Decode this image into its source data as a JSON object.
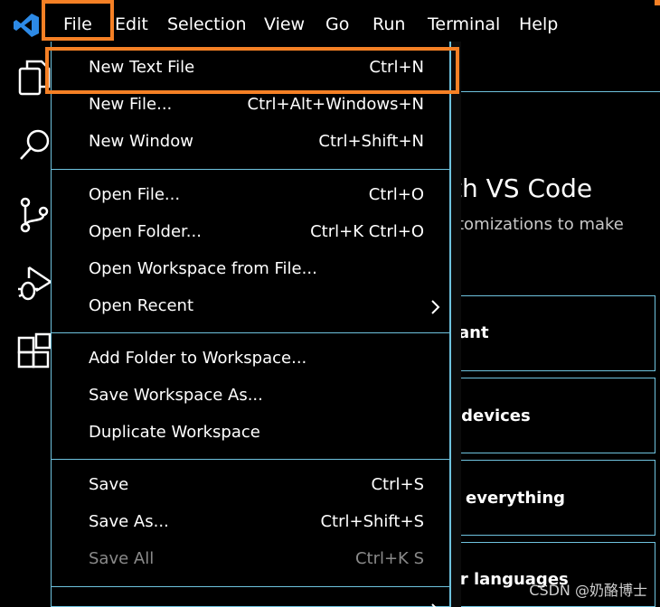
{
  "menubar": {
    "items": [
      {
        "label": "File"
      },
      {
        "label": "Edit"
      },
      {
        "label": "Selection"
      },
      {
        "label": "View"
      },
      {
        "label": "Go"
      },
      {
        "label": "Run"
      },
      {
        "label": "Terminal"
      },
      {
        "label": "Help"
      }
    ]
  },
  "file_menu": {
    "groups": [
      [
        {
          "label": "New Text File",
          "shortcut": "Ctrl+N"
        },
        {
          "label": "New File...",
          "shortcut": "Ctrl+Alt+Windows+N"
        },
        {
          "label": "New Window",
          "shortcut": "Ctrl+Shift+N"
        }
      ],
      [
        {
          "label": "Open File...",
          "shortcut": "Ctrl+O"
        },
        {
          "label": "Open Folder...",
          "shortcut": "Ctrl+K Ctrl+O"
        },
        {
          "label": "Open Workspace from File...",
          "shortcut": ""
        },
        {
          "label": "Open Recent",
          "shortcut": ""
        }
      ],
      [
        {
          "label": "Add Folder to Workspace...",
          "shortcut": ""
        },
        {
          "label": "Save Workspace As...",
          "shortcut": ""
        },
        {
          "label": "Duplicate Workspace",
          "shortcut": ""
        }
      ],
      [
        {
          "label": "Save",
          "shortcut": "Ctrl+S"
        },
        {
          "label": "Save As...",
          "shortcut": "Ctrl+Shift+S"
        },
        {
          "label": "Save All",
          "shortcut": "Ctrl+K S",
          "disabled": true
        }
      ]
    ]
  },
  "welcome": {
    "title_fragment": "th VS Code",
    "subtitle_fragment": "tomizations to make",
    "cards": [
      {
        "label": "ant"
      },
      {
        "label": "r devices"
      },
      {
        "label": "everything"
      },
      {
        "label": "ur languages"
      }
    ]
  },
  "watermark": "CSDN @奶酪博士",
  "icons": {
    "app": "vscode-logo-icon",
    "explorer": "files-icon",
    "search": "search-icon",
    "scm": "source-control-icon",
    "debug": "run-debug-icon",
    "extensions": "extensions-icon",
    "submenu": "chevron-right-icon"
  },
  "colors": {
    "highlight": "#f58025",
    "border": "#6fc3df",
    "vscode_blue": "#2d8ae6"
  }
}
